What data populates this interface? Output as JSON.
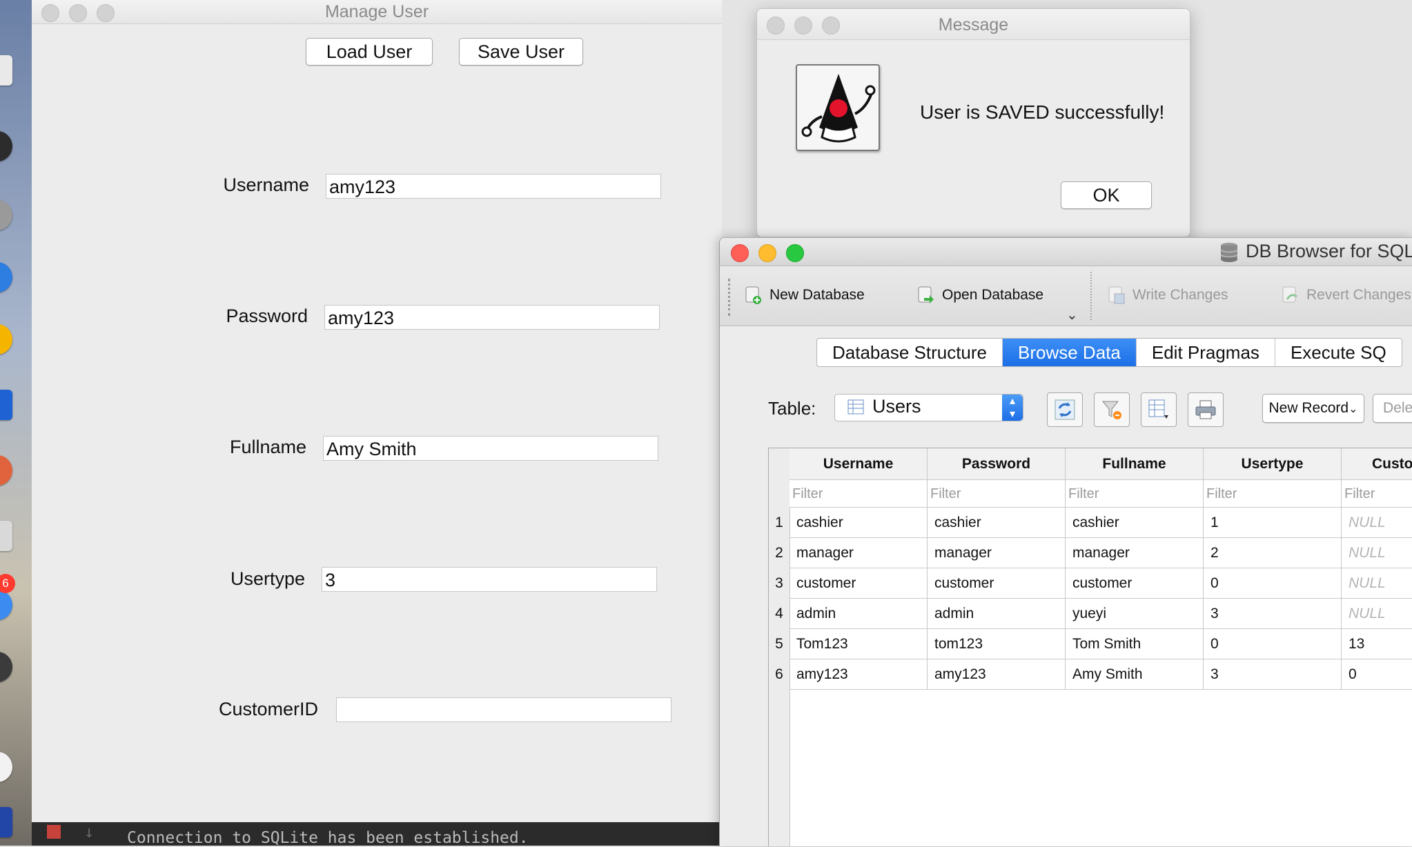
{
  "manage_user": {
    "title": "Manage User",
    "load_label": "Load User",
    "save_label": "Save User",
    "fields": [
      {
        "label": "Username",
        "value": "amy123"
      },
      {
        "label": "Password",
        "value": "amy123"
      },
      {
        "label": "Fullname",
        "value": "Amy Smith"
      },
      {
        "label": "Usertype",
        "value": "3"
      },
      {
        "label": "CustomerID",
        "value": ""
      }
    ]
  },
  "console": {
    "message": "Connection to SQLite has been established."
  },
  "dock": {
    "badge": "6"
  },
  "dialog": {
    "title": "Message",
    "text": "User is SAVED successfully!",
    "ok_label": "OK",
    "icon": "java-duke-icon"
  },
  "db_browser": {
    "title": "DB Browser for SQL",
    "toolbar": {
      "new_db": "New Database",
      "open_db": "Open Database",
      "write": "Write Changes",
      "revert": "Revert Changes"
    },
    "tabs": [
      "Database Structure",
      "Browse Data",
      "Edit Pragmas",
      "Execute SQ"
    ],
    "active_tab": "Browse Data",
    "table_label": "Table:",
    "table_selected": "Users",
    "new_record": "New Record",
    "delete_record": "Dele",
    "filter_placeholder": "Filter",
    "columns": [
      "Username",
      "Password",
      "Fullname",
      "Usertype",
      "Custo"
    ],
    "rows": [
      {
        "n": "1",
        "cells": [
          "cashier",
          "cashier",
          "cashier",
          "1",
          "NULL"
        ]
      },
      {
        "n": "2",
        "cells": [
          "manager",
          "manager",
          "manager",
          "2",
          "NULL"
        ]
      },
      {
        "n": "3",
        "cells": [
          "customer",
          "customer",
          "customer",
          "0",
          "NULL"
        ]
      },
      {
        "n": "4",
        "cells": [
          "admin",
          "admin",
          "yueyi",
          "3",
          "NULL"
        ]
      },
      {
        "n": "5",
        "cells": [
          "Tom123",
          "tom123",
          "Tom Smith",
          "0",
          "13"
        ]
      },
      {
        "n": "6",
        "cells": [
          "amy123",
          "amy123",
          "Amy Smith",
          "3",
          "0"
        ]
      }
    ]
  },
  "colors": {
    "active_tab": "#1c6fe6",
    "close_light": "#fe5f57",
    "min_light": "#febc2e",
    "max_light": "#28c840"
  }
}
